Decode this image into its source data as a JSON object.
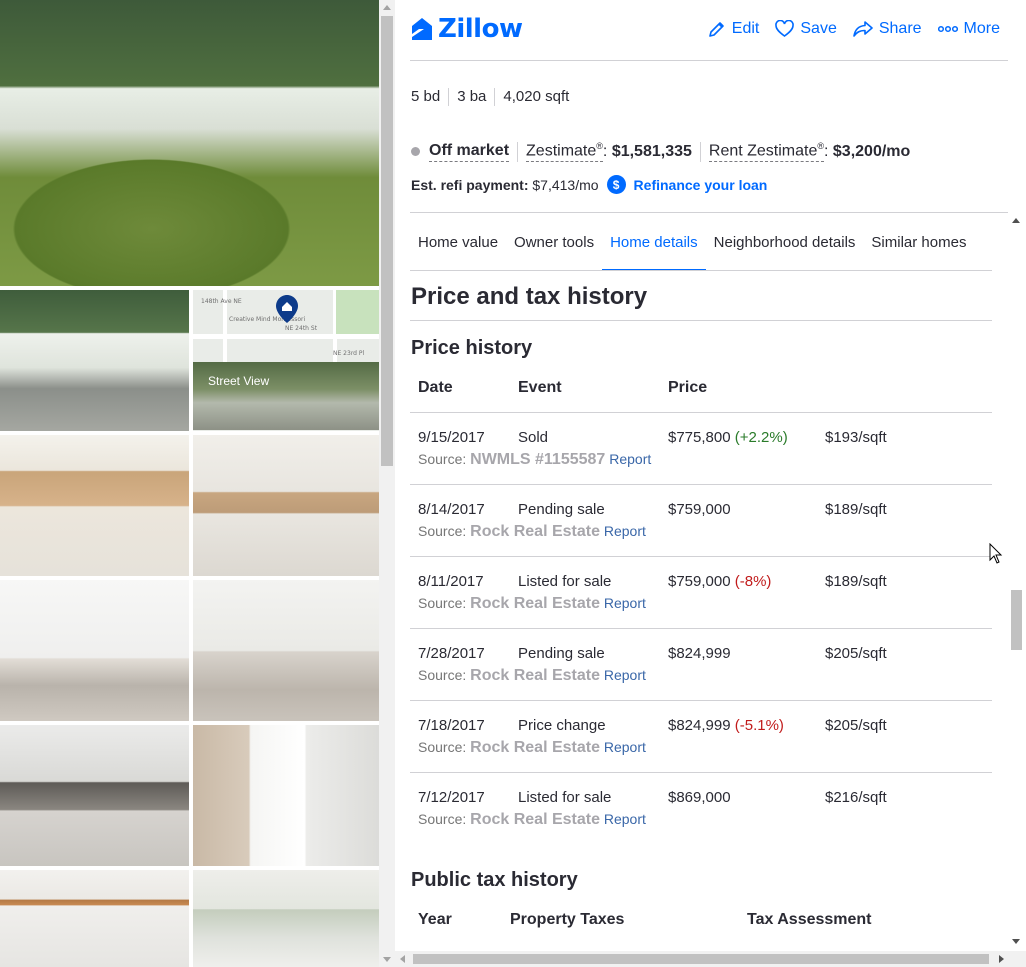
{
  "brand": {
    "name": "Zillow",
    "color": "#006aff"
  },
  "actions": [
    {
      "label": "Edit",
      "icon": "pencil-icon"
    },
    {
      "label": "Save",
      "icon": "heart-icon"
    },
    {
      "label": "Share",
      "icon": "share-arrow-icon"
    },
    {
      "label": "More",
      "icon": "more-dots-icon"
    }
  ],
  "facts": {
    "beds": "5 bd",
    "baths": "3 ba",
    "sqft": "4,020 sqft"
  },
  "status": {
    "label": "Off market",
    "zestimate_label": "Zestimate",
    "zestimate_value": "$1,581,335",
    "rent_label": "Rent Zestimate",
    "rent_value": "$3,200/mo",
    "registered": "®"
  },
  "refi": {
    "label": "Est. refi payment:",
    "value": "$7,413/mo",
    "icon_symbol": "$",
    "link": "Refinance your loan"
  },
  "tabs": [
    "Home value",
    "Owner tools",
    "Home details",
    "Neighborhood details",
    "Similar homes"
  ],
  "active_tab": "Home details",
  "section_title": "Price and tax history",
  "price_history": {
    "title": "Price history",
    "headers": {
      "date": "Date",
      "event": "Event",
      "price": "Price"
    },
    "source_prefix": "Source:",
    "report_label": "Report",
    "rows": [
      {
        "date": "9/15/2017",
        "event": "Sold",
        "price": "$775,800",
        "change": "(+2.2%)",
        "change_dir": "pos",
        "per_sqft": "$193/sqft",
        "source": "NWMLS #1155587"
      },
      {
        "date": "8/14/2017",
        "event": "Pending sale",
        "price": "$759,000",
        "change": "",
        "change_dir": "",
        "per_sqft": "$189/sqft",
        "source": "Rock Real Estate"
      },
      {
        "date": "8/11/2017",
        "event": "Listed for sale",
        "price": "$759,000",
        "change": "(-8%)",
        "change_dir": "neg",
        "per_sqft": "$189/sqft",
        "source": "Rock Real Estate"
      },
      {
        "date": "7/28/2017",
        "event": "Pending sale",
        "price": "$824,999",
        "change": "",
        "change_dir": "",
        "per_sqft": "$205/sqft",
        "source": "Rock Real Estate"
      },
      {
        "date": "7/18/2017",
        "event": "Price change",
        "price": "$824,999",
        "change": "(-5.1%)",
        "change_dir": "neg",
        "per_sqft": "$205/sqft",
        "source": "Rock Real Estate"
      },
      {
        "date": "7/12/2017",
        "event": "Listed for sale",
        "price": "$869,000",
        "change": "",
        "change_dir": "",
        "per_sqft": "$216/sqft",
        "source": "Rock Real Estate"
      }
    ]
  },
  "tax_history": {
    "title": "Public tax history",
    "headers": {
      "year": "Year",
      "taxes": "Property Taxes",
      "assessment": "Tax Assessment"
    }
  },
  "gallery": {
    "street_view_label": "Street View",
    "map_labels": {
      "place": "Creative Mind Montessori",
      "street1": "NE 24th St",
      "street2": "NE 23rd Pl",
      "avenue": "148th Ave NE"
    },
    "photos": [
      "exterior",
      "house-front",
      "street-view-map",
      "kitchen",
      "kitchen-dining",
      "living-room",
      "living-room-2",
      "bedroom",
      "bathroom",
      "closet",
      "dining-room"
    ]
  },
  "colors": {
    "accent": "#006aff",
    "text": "#2a2a33",
    "positive": "#2a7b2a",
    "negative": "#c11b1b",
    "muted": "#a7a6ab",
    "rule": "#d1d1d5"
  }
}
